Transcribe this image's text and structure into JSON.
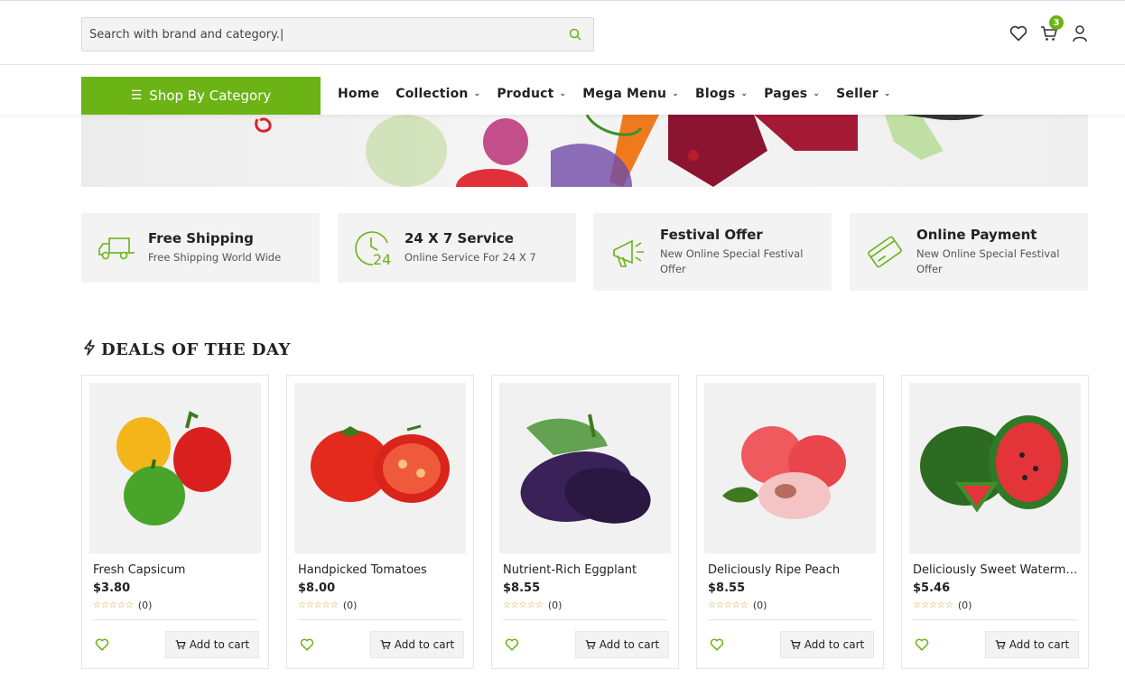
{
  "header": {
    "search_placeholder": "Search with brand and category.|",
    "cart_count": "3"
  },
  "nav": {
    "category_button": "Shop By Category",
    "menu": [
      {
        "label": "Home",
        "has_dropdown": false
      },
      {
        "label": "Collection",
        "has_dropdown": true
      },
      {
        "label": "Product",
        "has_dropdown": true
      },
      {
        "label": "Mega Menu",
        "has_dropdown": true
      },
      {
        "label": "Blogs",
        "has_dropdown": true
      },
      {
        "label": "Pages",
        "has_dropdown": true
      },
      {
        "label": "Seller",
        "has_dropdown": true
      }
    ]
  },
  "features": [
    {
      "title": "Free Shipping",
      "subtitle": "Free Shipping World Wide",
      "icon": "truck-icon"
    },
    {
      "title": "24 X 7 Service",
      "subtitle": "Online Service For 24 X 7",
      "icon": "clock-24-icon"
    },
    {
      "title": "Festival Offer",
      "subtitle": "New Online Special Festival Offer",
      "icon": "megaphone-icon"
    },
    {
      "title": "Online Payment",
      "subtitle": "New Online Special Festival Offer",
      "icon": "credit-card-icon"
    }
  ],
  "deals": {
    "title": "DEALS OF THE DAY",
    "add_to_cart_label": "Add to cart",
    "products": [
      {
        "name": "Fresh Capsicum",
        "price": "$3.80",
        "rating_count": "(0)",
        "rating": 0
      },
      {
        "name": "Handpicked Tomatoes",
        "price": "$8.00",
        "rating_count": "(0)",
        "rating": 0
      },
      {
        "name": "Nutrient-Rich Eggplant",
        "price": "$8.55",
        "rating_count": "(0)",
        "rating": 0
      },
      {
        "name": "Deliciously Ripe Peach",
        "price": "$8.55",
        "rating_count": "(0)",
        "rating": 0
      },
      {
        "name": "Deliciously Sweet Watermelon",
        "price": "$5.46",
        "rating_count": "(0)",
        "rating": 0
      }
    ]
  },
  "colors": {
    "accent": "#6cb316",
    "panel": "#f3f3f3"
  }
}
